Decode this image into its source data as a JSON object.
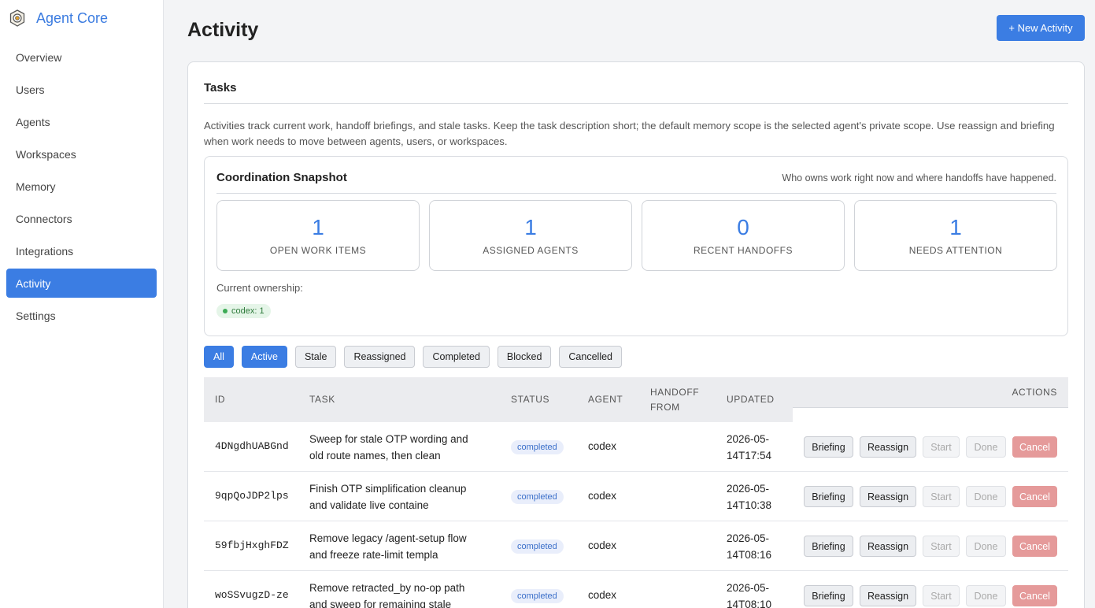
{
  "app": {
    "title": "Agent Core"
  },
  "sidebar": {
    "items": [
      {
        "label": "Overview"
      },
      {
        "label": "Users"
      },
      {
        "label": "Agents"
      },
      {
        "label": "Workspaces"
      },
      {
        "label": "Memory"
      },
      {
        "label": "Connectors"
      },
      {
        "label": "Integrations"
      },
      {
        "label": "Activity",
        "active": true
      },
      {
        "label": "Settings"
      }
    ]
  },
  "header": {
    "title": "Activity",
    "new_button": "+ New Activity"
  },
  "tasks": {
    "heading": "Tasks",
    "description": "Activities track current work, handoff briefings, and stale tasks. Keep the task description short; the default memory scope is the selected agent's private scope. Use reassign and briefing when work needs to move between agents, users, or workspaces."
  },
  "snapshot": {
    "title": "Coordination Snapshot",
    "subtitle": "Who owns work right now and where handoffs have happened.",
    "stats": [
      {
        "value": "1",
        "label": "OPEN WORK ITEMS"
      },
      {
        "value": "1",
        "label": "ASSIGNED AGENTS"
      },
      {
        "value": "0",
        "label": "RECENT HANDOFFS"
      },
      {
        "value": "1",
        "label": "NEEDS ATTENTION"
      }
    ],
    "ownership_label": "Current ownership:",
    "ownership_chip": "codex: 1"
  },
  "filters": [
    "All",
    "Active",
    "Stale",
    "Reassigned",
    "Completed",
    "Blocked",
    "Cancelled"
  ],
  "table": {
    "headers": {
      "id": "ID",
      "task": "TASK",
      "status": "STATUS",
      "agent": "AGENT",
      "handoff_1": "HANDOFF",
      "handoff_2": "FROM",
      "updated": "UPDATED",
      "actions": "ACTIONS"
    },
    "rows": [
      {
        "id": "4DNgdhUABGnd",
        "task_1": "Sweep for stale OTP wording and",
        "task_2": "old route names, then clean",
        "status": "completed",
        "agent": "codex",
        "handoff": "",
        "updated_1": "2026-05-",
        "updated_2": "14T17:54"
      },
      {
        "id": "9qpQoJDP2lps",
        "task_1": "Finish OTP simplification cleanup",
        "task_2": "and validate live containe",
        "status": "completed",
        "agent": "codex",
        "handoff": "",
        "updated_1": "2026-05-",
        "updated_2": "14T10:38"
      },
      {
        "id": "59fbjHxghFDZ",
        "task_1": "Remove legacy /agent-setup flow",
        "task_2": "and freeze rate-limit templa",
        "status": "completed",
        "agent": "codex",
        "handoff": "",
        "updated_1": "2026-05-",
        "updated_2": "14T08:16"
      },
      {
        "id": "woSSvugzD-ze",
        "task_1": "Remove retracted_by no-op path",
        "task_2": "and sweep for remaining stale",
        "status": "completed",
        "agent": "codex",
        "handoff": "",
        "updated_1": "2026-05-",
        "updated_2": "14T08:10"
      }
    ],
    "actions": [
      "Briefing",
      "Reassign",
      "Start",
      "Done",
      "Cancel"
    ]
  }
}
